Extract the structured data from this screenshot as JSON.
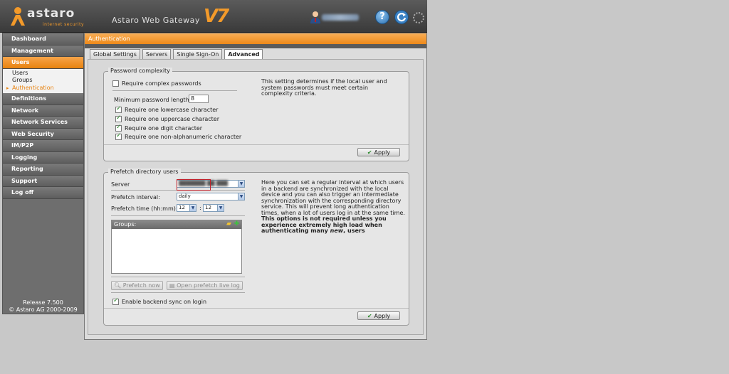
{
  "header": {
    "brand": "astaro",
    "tagline": "internet security",
    "product_title": "Astaro Web Gateway",
    "version_mark": "V7",
    "help_label": "?"
  },
  "sidebar": {
    "items": [
      {
        "label": "Dashboard"
      },
      {
        "label": "Management"
      },
      {
        "label": "Users",
        "active": true
      },
      {
        "label": "Definitions"
      },
      {
        "label": "Network"
      },
      {
        "label": "Network Services"
      },
      {
        "label": "Web Security"
      },
      {
        "label": "IM/P2P"
      },
      {
        "label": "Logging"
      },
      {
        "label": "Reporting"
      },
      {
        "label": "Support"
      },
      {
        "label": "Log off"
      }
    ],
    "users_sub": [
      "Users",
      "Groups",
      "Authentication"
    ],
    "release": "Release 7.500",
    "copyright": "© Astaro AG 2000-2009"
  },
  "main": {
    "title": "Authentication",
    "tabs": [
      "Global Settings",
      "Servers",
      "Single Sign-On",
      "Advanced"
    ],
    "active_tab": "Advanced"
  },
  "password": {
    "legend": "Password complexity",
    "require_complex": "Require complex passwords",
    "min_length_label": "Minimum password length:",
    "min_length_value": "8",
    "options": [
      "Require one lowercase character",
      "Require one uppercase character",
      "Require one digit character",
      "Require one non-alphanumeric character"
    ],
    "help": "This setting determines if the local user and system passwords must meet certain complexity criteria.",
    "apply": "Apply"
  },
  "prefetch": {
    "legend": "Prefetch directory users",
    "server_label": "Server",
    "interval_label": "Prefetch interval:",
    "interval_value": "daily",
    "time_label": "Prefetch time (hh:mm):",
    "time_hour": "12",
    "time_minute": "12",
    "time_sep": ":",
    "groups_label": "Groups:",
    "prefetch_now": "Prefetch now",
    "open_log": "Open prefetch live log",
    "enable_sync": "Enable backend sync on login",
    "help_line1": "Here you can set a regular interval at which users",
    "help_line2": "in a backend are synchronized with the local",
    "help_line3": "device and you can also trigger an intermediate",
    "help_line4": "synchronization with the corresponding directory",
    "help_line5": "service. This will prevent long authentication",
    "help_line6": "times, when a lot of users log in at the same time.",
    "help_bold1": "This options is not required unless you",
    "help_bold2": "experience extremely high load when",
    "help_bold3_a": "authenticating many ",
    "help_bold3_b": "new",
    "help_bold3_c": ", users",
    "apply": "Apply"
  },
  "colors": {
    "accent": "#ee8a1a",
    "header_bg": "#4a4a4a",
    "sidebar_bg": "#6e6e6e",
    "panel_bg": "#dcdcdc"
  }
}
